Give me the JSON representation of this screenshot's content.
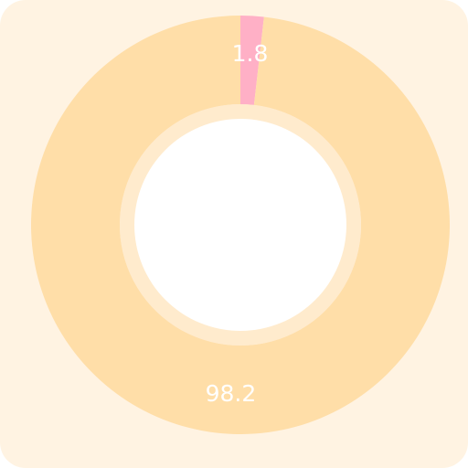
{
  "chart_data": {
    "type": "pie",
    "variant": "donut",
    "title": "",
    "slices": [
      {
        "label": "1.8",
        "value": 1.8,
        "color": "#ffb0c6"
      },
      {
        "label": "98.2",
        "value": 98.2,
        "color": "#ffdea8"
      }
    ],
    "legend": "none",
    "start_angle_deg": 0,
    "direction": "clockwise"
  },
  "colors": {
    "card_background": "#fff3e2",
    "inner_ring": "#ffe9c9",
    "hole": "#ffffff",
    "label_text": "#ffffff"
  }
}
